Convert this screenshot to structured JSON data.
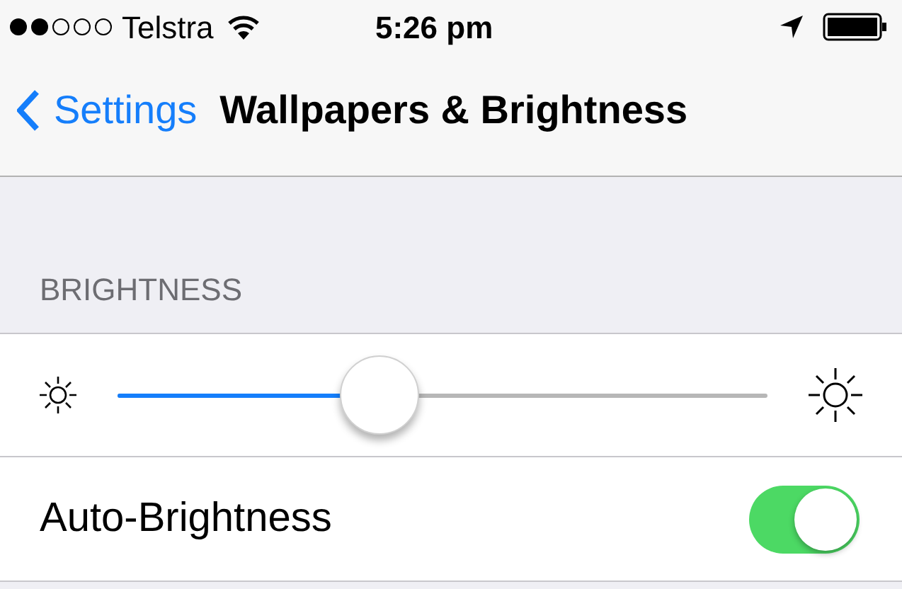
{
  "status_bar": {
    "carrier": "Telstra",
    "time": "5:26 pm"
  },
  "nav_bar": {
    "back": "Settings",
    "title": "Wallpapers & Brightness"
  },
  "section": {
    "header": "BRIGHTNESS"
  },
  "brightness": {
    "level": 0.403
  },
  "rows": [
    {
      "kind": "toggle",
      "label": "Auto-Brightness",
      "on": true
    }
  ]
}
